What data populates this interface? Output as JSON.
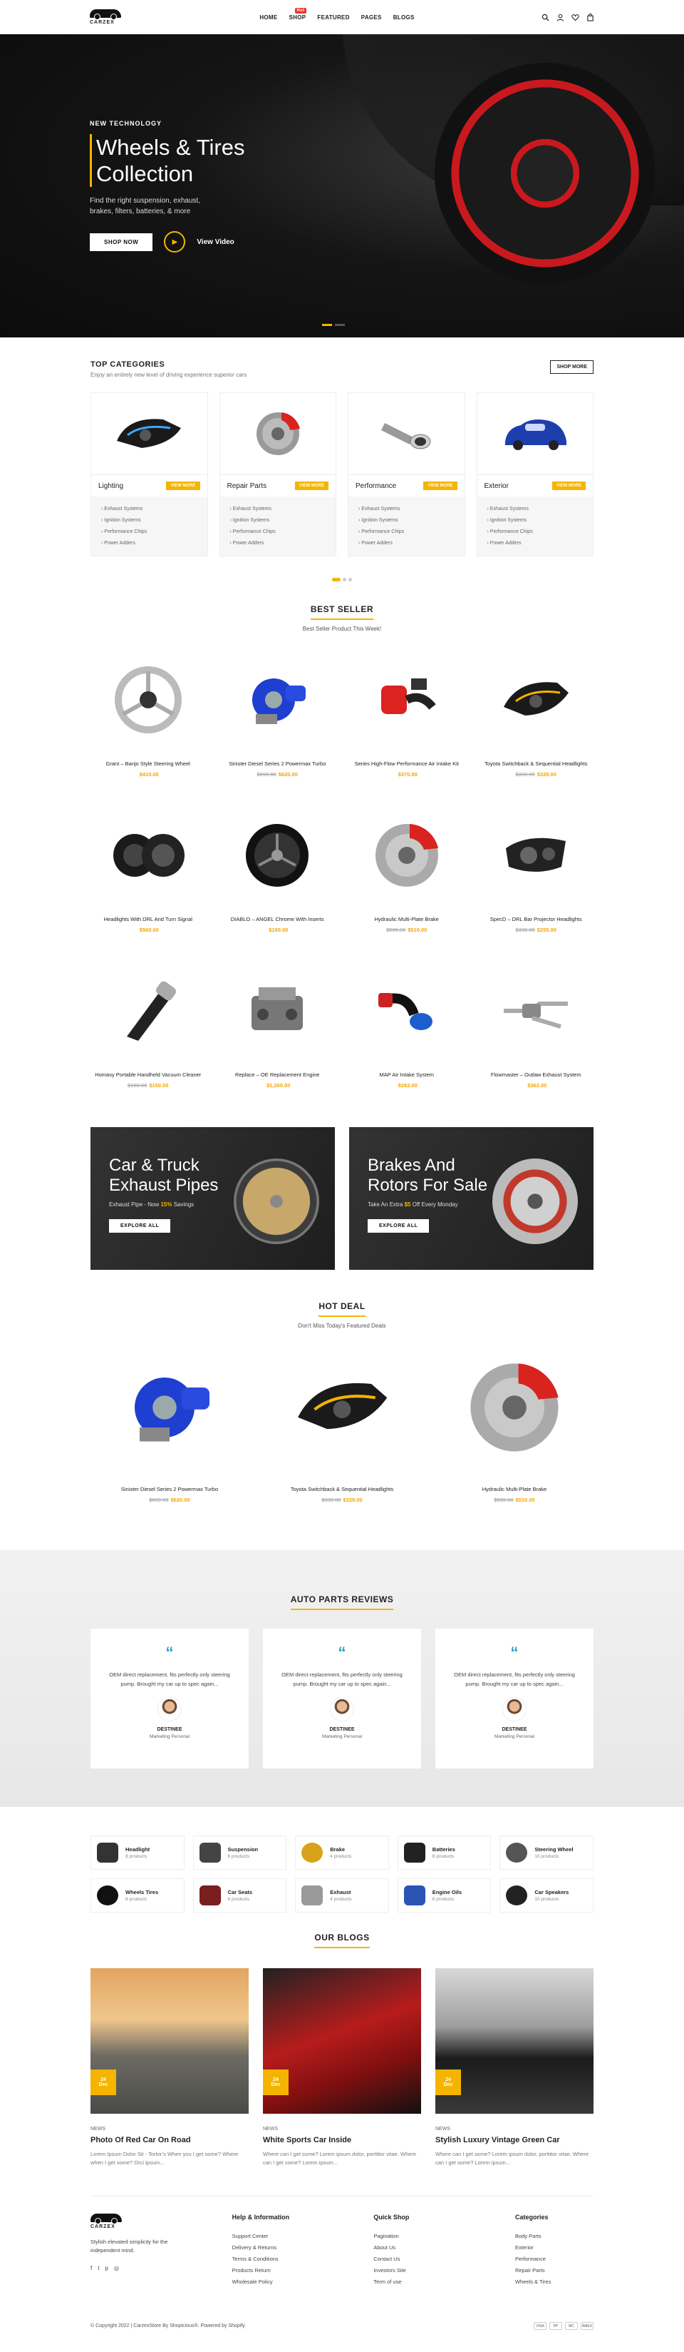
{
  "header": {
    "logo_text": "CARZEX",
    "nav": [
      "HOME",
      "SHOP",
      "FEATURED",
      "PAGES",
      "BLOGS"
    ],
    "shop_badge": "Hot",
    "icons": [
      "search-icon",
      "user-icon",
      "heart-icon",
      "cart-icon"
    ]
  },
  "hero": {
    "kicker": "NEW TECHNOLOGY",
    "title_line1": "Wheels & Tires",
    "title_line2": "Collection",
    "subtitle": "Find the right suspension, exhaust, brakes, filters, batteries, & more",
    "shop_button": "SHOP NOW",
    "video_label": "View Video"
  },
  "categories": {
    "title": "TOP CATEGORIES",
    "subtitle": "Enjoy an entirely new level of driving experience superior cars",
    "shop_more": "SHOP MORE",
    "view_more": "VIEW MORE",
    "items": [
      {
        "name": "Lighting",
        "list": [
          "Exhaust Systems",
          "Ignition Systems",
          "Performance Chips",
          "Power Adders"
        ]
      },
      {
        "name": "Repair Parts",
        "list": [
          "Exhaust Systems",
          "Ignition Systems",
          "Performance Chips",
          "Power Adders"
        ]
      },
      {
        "name": "Performance",
        "list": [
          "Exhaust Systems",
          "Ignition Systems",
          "Performance Chips",
          "Power Adders"
        ]
      },
      {
        "name": "Exterior",
        "list": [
          "Exhaust Systems",
          "Ignition Systems",
          "Performance Chips",
          "Power Adders"
        ]
      }
    ]
  },
  "best_seller": {
    "title": "BEST SELLER",
    "subtitle": "Best Seller Product This Week!",
    "products": [
      {
        "name": "Grant – Banjo Style Steering Wheel",
        "old": "",
        "price": "$410.00"
      },
      {
        "name": "Sinister Diesel Series 2 Powermax Turbo",
        "old": "$699.00",
        "price": "$620.00"
      },
      {
        "name": "Series High-Flow Performance Air Intake Kit",
        "old": "",
        "price": "$370.00"
      },
      {
        "name": "Toyota Switchback & Sequential Headlights",
        "old": "$339.00",
        "price": "$329.00"
      },
      {
        "name": "Headlights With DRL And Turn Signal",
        "old": "",
        "price": "$560.00"
      },
      {
        "name": "DIABLO – ANGEL Chrome With Inserts",
        "old": "",
        "price": "$190.00"
      },
      {
        "name": "Hydraulic Multi-Plate Brake",
        "old": "$565.00",
        "price": "$510.00"
      },
      {
        "name": "SpecD – DRL Bar Projector Headlights",
        "old": "$336.00",
        "price": "$255.00"
      },
      {
        "name": "Homasy Portable Handheld Vacuum Cleaner",
        "old": "$160.00",
        "price": "$150.00"
      },
      {
        "name": "Replace – OE Replacement Engine",
        "old": "",
        "price": "$1,260.00"
      },
      {
        "name": "MAP Air Intake System",
        "old": "",
        "price": "$282.00"
      },
      {
        "name": "Flowmaster – Outlaw Exhaust System",
        "old": "",
        "price": "$362.00"
      }
    ]
  },
  "banners": [
    {
      "title_line1": "Car & Truck",
      "title_line2": "Exhaust Pipes",
      "text_pre": "Exhaust Pipe - Now ",
      "highlight": "15%",
      "text_post": " Savings",
      "button": "EXPLORE ALL"
    },
    {
      "title_line1": "Brakes And",
      "title_line2": "Rotors For Sale",
      "text_pre": "Take An Extra ",
      "highlight": "$5",
      "text_post": " Off Every Monday",
      "button": "EXPLORE ALL"
    }
  ],
  "hot_deal": {
    "title": "HOT DEAL",
    "subtitle": "Don't Miss Today's Featured Deals",
    "products": [
      {
        "name": "Sinister Diesel Series 2 Powermax Turbo",
        "old": "$699.00",
        "price": "$620.00"
      },
      {
        "name": "Toyota Switchback & Sequential Headlights",
        "old": "$339.00",
        "price": "$329.00"
      },
      {
        "name": "Hydraulic Multi-Plate Brake",
        "old": "$565.00",
        "price": "$510.00"
      }
    ]
  },
  "reviews": {
    "title": "AUTO PARTS REVIEWS",
    "items": [
      {
        "text": "OEM direct replacement, fits perfectly only steering pump. Brought my car up to spec again...",
        "name": "DESTINEE",
        "role": "Marketing Personal"
      },
      {
        "text": "OEM direct replacement, fits perfectly only steering pump. Brought my car up to spec again...",
        "name": "DESTINEE",
        "role": "Marketing Personal"
      },
      {
        "text": "OEM direct replacement, fits perfectly only steering pump. Brought my car up to spec again...",
        "name": "DESTINEE",
        "role": "Marketing Personal"
      }
    ]
  },
  "shop_categories": [
    {
      "name": "Headlight",
      "count": "8 products",
      "icon": "headlight-icon"
    },
    {
      "name": "Suspension",
      "count": "6 products",
      "icon": "suspension-icon"
    },
    {
      "name": "Brake",
      "count": "4 products",
      "icon": "brake-icon"
    },
    {
      "name": "Batteries",
      "count": "8 products",
      "icon": "battery-icon"
    },
    {
      "name": "Steering Wheel",
      "count": "10 products",
      "icon": "steering-wheel-icon"
    },
    {
      "name": "Wheels Tires",
      "count": "8 products",
      "icon": "tire-icon"
    },
    {
      "name": "Car Seats",
      "count": "6 products",
      "icon": "car-seat-icon"
    },
    {
      "name": "Exhaust",
      "count": "4 products",
      "icon": "exhaust-icon"
    },
    {
      "name": "Engine Oils",
      "count": "8 products",
      "icon": "engine-oil-icon"
    },
    {
      "name": "Car Speakers",
      "count": "10 products",
      "icon": "speaker-icon"
    }
  ],
  "blogs": {
    "title": "OUR BLOGS",
    "items": [
      {
        "day": "24",
        "month": "Dec",
        "category": "NEWS",
        "title": "Photo Of Red Car On Road",
        "excerpt": "Lorem Ipsum Dolor Sit - Tortor’s When you I get some? Where when I get some? Orci ipsum..."
      },
      {
        "day": "24",
        "month": "Dec",
        "category": "NEWS",
        "title": "White Sports Car Inside",
        "excerpt": "Where can I get some? Lorem ipsum dolor, porttitor vitae. Where can I get some? Lorem ipsum..."
      },
      {
        "day": "24",
        "month": "Dec",
        "category": "NEWS",
        "title": "Stylish Luxury Vintage Green Car",
        "excerpt": "Where can I get some? Lorem ipsum dolor, porttitor vitae. Where can I get some? Lorem ipsum..."
      }
    ]
  },
  "footer": {
    "about": "Stylish elevated simplicity for the independent mind.",
    "cols": [
      {
        "title": "Help & Information",
        "links": [
          "Support Center",
          "Delivery & Returns",
          "Terms & Conditions",
          "Products Return",
          "Wholesale Policy"
        ]
      },
      {
        "title": "Quick Shop",
        "links": [
          "Pagination",
          "About Us",
          "Contact Us",
          "Investors Site",
          "Term of use"
        ]
      },
      {
        "title": "Categories",
        "links": [
          "Body Parts",
          "Exterior",
          "Performance",
          "Repair Parts",
          "Wheels & Tires"
        ]
      }
    ],
    "copyright": "© Copyright 2022 | CarzexStore By Shopicious®. Powered by Shopify.",
    "payments": [
      "VISA",
      "PP",
      "MC",
      "AMEX"
    ]
  }
}
